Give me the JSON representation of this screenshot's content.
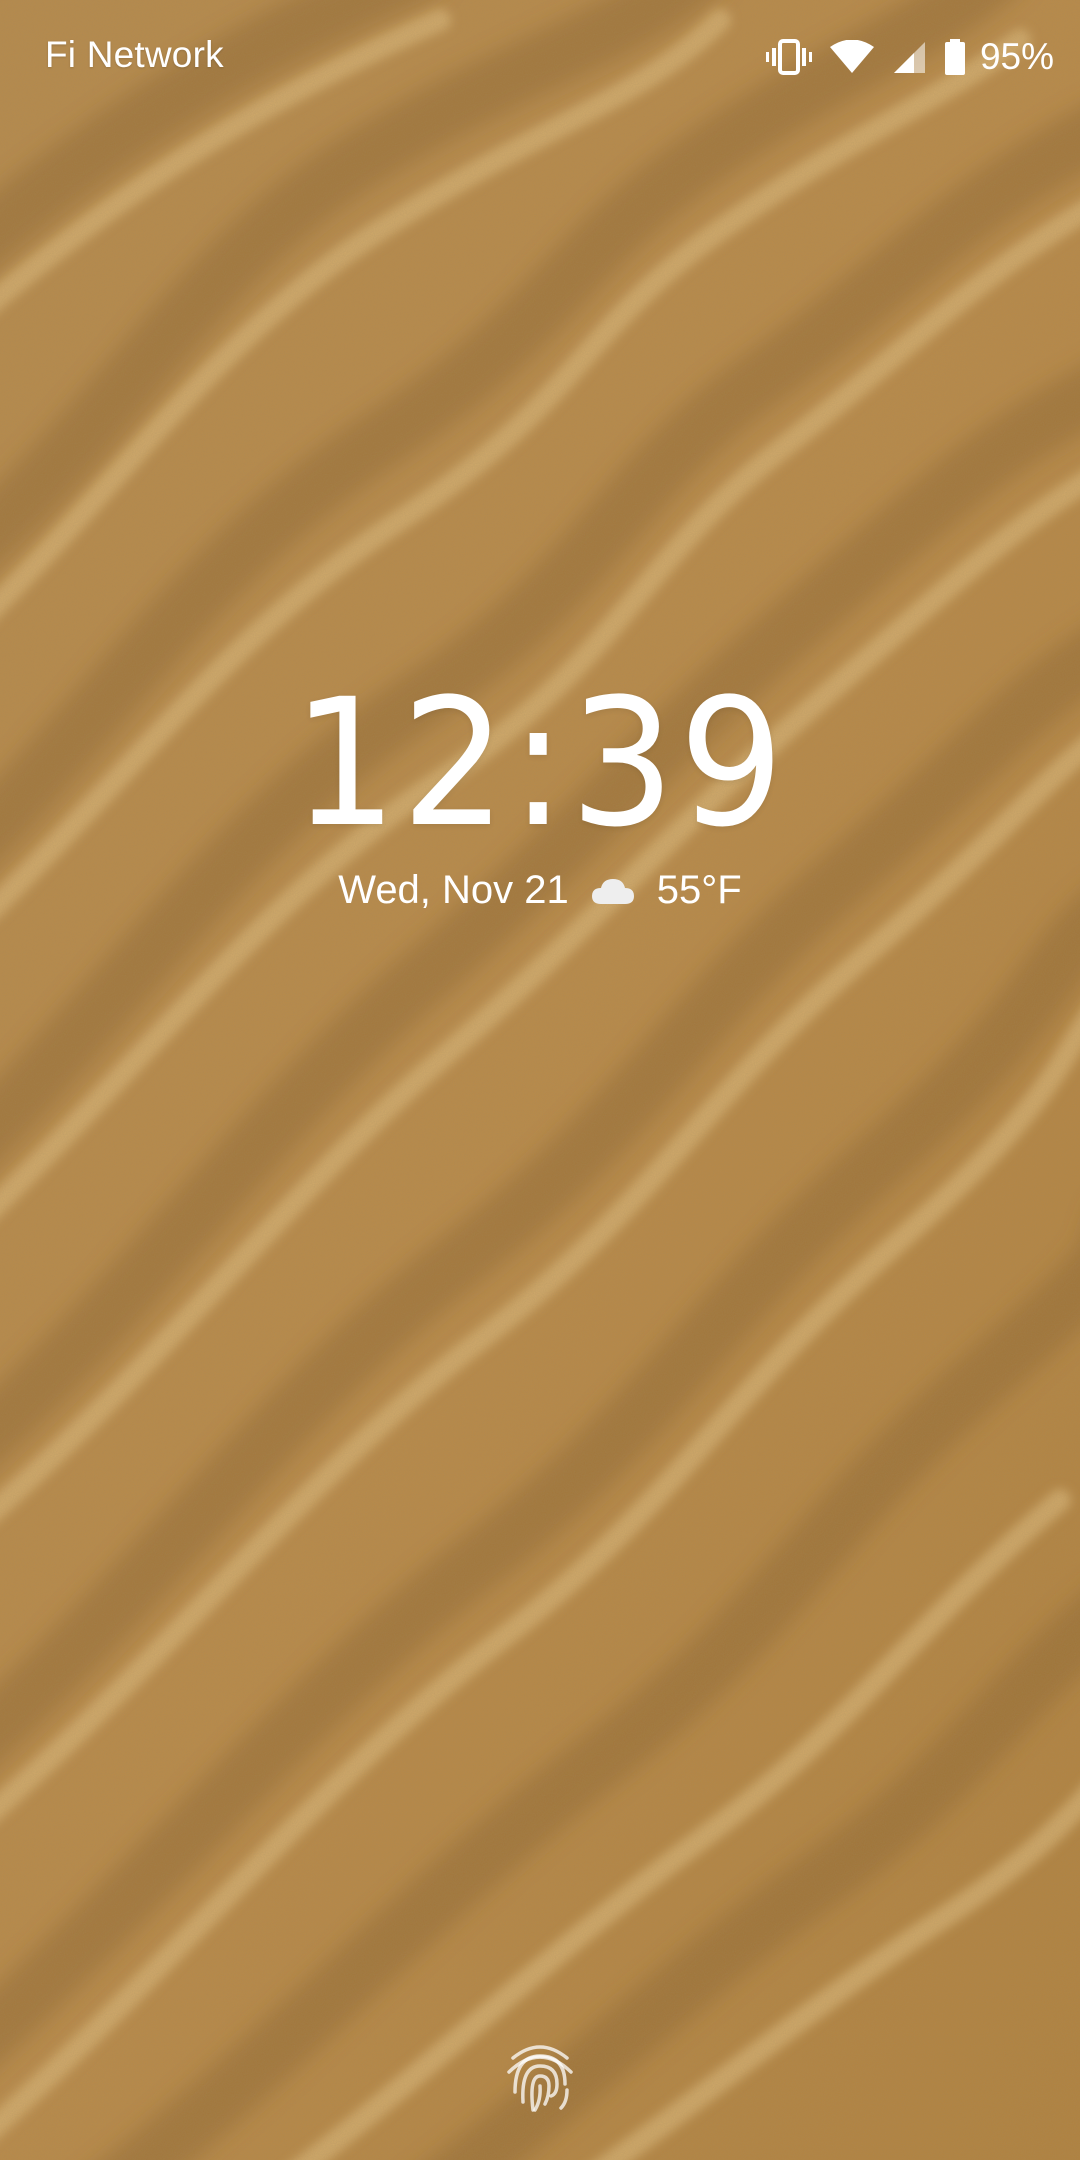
{
  "status_bar": {
    "carrier": "Fi Network",
    "battery_percent": "95%",
    "icons": [
      "vibrate-icon",
      "wifi-icon",
      "cell-signal-icon",
      "battery-icon"
    ]
  },
  "lock_screen": {
    "time": "12:39",
    "date": "Wed, Nov 21",
    "weather_icon": "cloud-icon",
    "temperature": "55°F"
  },
  "fingerprint": {
    "icon": "fingerprint-icon"
  },
  "colors": {
    "sand_light": "#c9a061",
    "sand_mid": "#b8894a",
    "sand_dark": "#8e6630",
    "text": "#ffffff"
  }
}
